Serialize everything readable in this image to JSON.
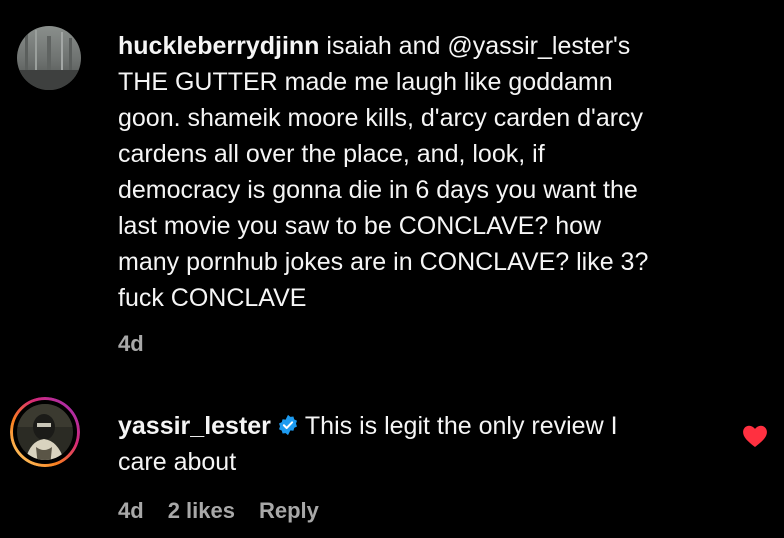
{
  "comments": [
    {
      "username": "huckleberrydjinn",
      "lines": [
        " isaiah and @yassir_lester's",
        "THE GUTTER made me laugh like goddamn",
        "goon. shameik moore kills, d'arcy carden d'arcy",
        "cardens all over the place, and, look, if",
        "democracy is gonna die in 6 days you want the",
        "last movie you saw to be CONCLAVE? how",
        "many pornhub jokes are in CONCLAVE? like 3?",
        "fuck CONCLAVE"
      ],
      "time": "4d"
    },
    {
      "username": "yassir_lester",
      "verified": true,
      "lines": [
        "This is legit the only review I",
        "care about"
      ],
      "time": "4d",
      "likes": "2 likes",
      "reply_label": "Reply",
      "liked": true
    }
  ],
  "colors": {
    "background": "#000000",
    "text": "#f5f5f5",
    "meta": "#a8a8a8",
    "verified": "#1d9bf0",
    "heart": "#ff3040",
    "story_ring_start": "#feda75",
    "story_ring_end": "#d62976"
  },
  "icons": {
    "verified": "verified-badge-icon",
    "heart": "heart-icon"
  }
}
